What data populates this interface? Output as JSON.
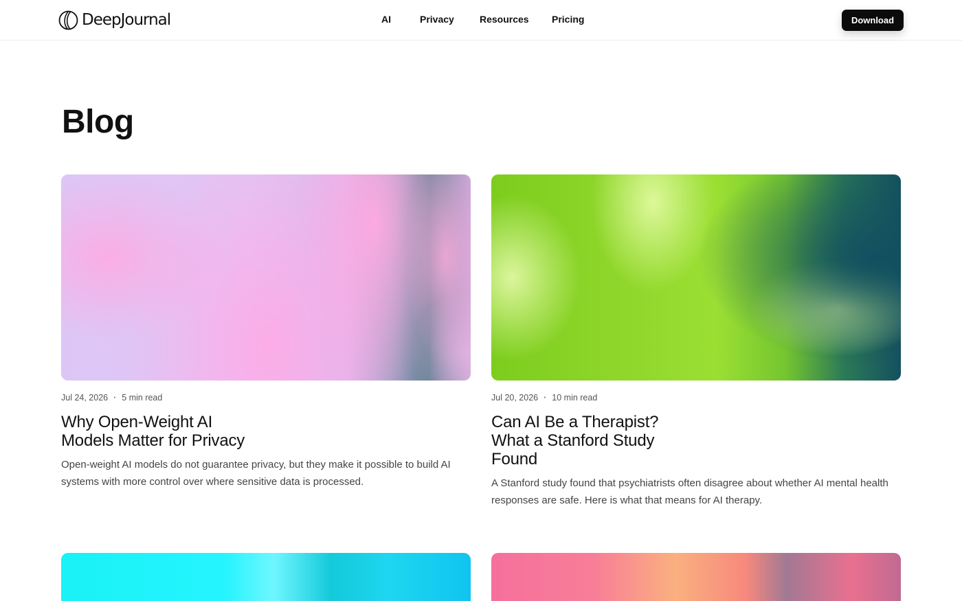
{
  "brand": {
    "name": "DeepJournal"
  },
  "nav": {
    "items": [
      {
        "label": "AI"
      },
      {
        "label": "Privacy"
      },
      {
        "label": "Resources"
      },
      {
        "label": "Pricing"
      }
    ],
    "download_label": "Download"
  },
  "page": {
    "title": "Blog"
  },
  "posts": [
    {
      "date": "Jul 24, 2026",
      "read_time": "5 min read",
      "title": "Why Open-Weight AI Models Matter for Privacy",
      "excerpt": "Open-weight AI models do not guarantee privacy, but they make it possible to build AI systems with more control over where sensitive data is processed.",
      "thumbnail_colors": [
        "#e0c6f6",
        "#ffaee4",
        "#5f7f90"
      ]
    },
    {
      "date": "Jul 20, 2026",
      "read_time": "10 min read",
      "title": "Can AI Be a Therapist? What a Stanford Study Found",
      "excerpt": "A Stanford study found that psychiatrists often disagree about whether AI mental health responses are safe. Here is what that means for AI therapy.",
      "thumbnail_colors": [
        "#8fd62a",
        "#e1faa0",
        "#14505f"
      ]
    },
    {
      "thumbnail_colors": [
        "#25f4ff",
        "#6ff6ff",
        "#14c9da"
      ]
    },
    {
      "thumbnail_colors": [
        "#f5709d",
        "#fab07f",
        "#a27994"
      ]
    }
  ],
  "colors": {
    "button_bg": "#0b0b0b",
    "text_primary": "#111111",
    "text_muted": "#555555"
  }
}
